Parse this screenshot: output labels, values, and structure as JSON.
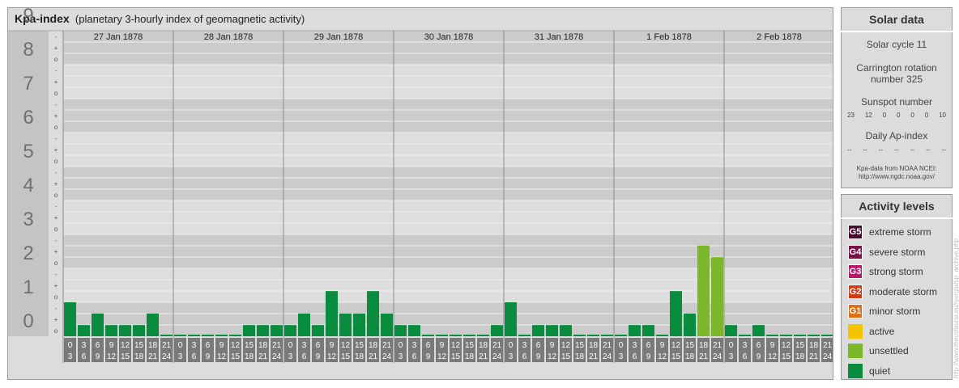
{
  "header": {
    "title": "Kpa-index",
    "subtitle": "(planetary 3-hourly index of geomagnetic activity)"
  },
  "chart_data": {
    "type": "bar",
    "title": "Kpa-index",
    "subtitle": "(planetary 3-hourly index of geomagnetic activity)",
    "ylim": [
      0,
      9
    ],
    "y_ticks": [
      "0",
      "1",
      "2",
      "3",
      "4",
      "5",
      "6",
      "7",
      "8",
      "9"
    ],
    "sub_ticks": [
      "o",
      "+",
      "-"
    ],
    "dates": [
      "27 Jan 1878",
      "28 Jan 1878",
      "29 Jan 1878",
      "30 Jan 1878",
      "31 Jan 1878",
      "1 Feb 1878",
      "2 Feb 1878"
    ],
    "interval_start": [
      "0",
      "3",
      "6",
      "9",
      "12",
      "15",
      "18",
      "21"
    ],
    "interval_end": [
      "3",
      "6",
      "9",
      "12",
      "15",
      "18",
      "21",
      "24"
    ],
    "values": [
      [
        1.0,
        0.33,
        0.67,
        0.33,
        0.33,
        0.33,
        0.67,
        0
      ],
      [
        0,
        0,
        0,
        0,
        0,
        0.33,
        0.33,
        0.33
      ],
      [
        0.33,
        0.67,
        0.33,
        1.33,
        0.67,
        0.67,
        1.33,
        0.67
      ],
      [
        0.33,
        0.33,
        0,
        0,
        0,
        0,
        0,
        0.33
      ],
      [
        1.0,
        0,
        0.33,
        0.33,
        0.33,
        0,
        0,
        0
      ],
      [
        0,
        0.33,
        0.33,
        0,
        1.33,
        0.67,
        2.67,
        2.33
      ],
      [
        0.33,
        0,
        0.33,
        0,
        0,
        0,
        0,
        0
      ]
    ],
    "colors": {
      "quiet": "#0a8c3e",
      "unsettled": "#7ab82a"
    },
    "grid": true
  },
  "solar": {
    "title": "Solar data",
    "cycle": "Solar cycle 11",
    "carrington_1": "Carrington rotation",
    "carrington_2": "number 325",
    "sunspot_title": "Sunspot number",
    "sunspots": [
      "23",
      "12",
      "0",
      "0",
      "0",
      "0",
      "10"
    ],
    "ap_title": "Daily Ap-index",
    "ap": [
      "--",
      "--",
      "--",
      "--",
      "--",
      "--",
      "--"
    ],
    "note_1": "Kpa-data from NOAA NCEI:",
    "note_2": "http://www.ngdc.noaa.gov/"
  },
  "levels": {
    "title": "Activity levels",
    "items": [
      {
        "code": "G5",
        "label": "extreme storm",
        "color": "#4a0a2a"
      },
      {
        "code": "G4",
        "label": "severe storm",
        "color": "#7a1048"
      },
      {
        "code": "G3",
        "label": "strong storm",
        "color": "#b8186a"
      },
      {
        "code": "G2",
        "label": "moderate storm",
        "color": "#d03c14"
      },
      {
        "code": "G1",
        "label": "minor storm",
        "color": "#e07018"
      },
      {
        "code": "",
        "label": "active",
        "color": "#f5c400"
      },
      {
        "code": "",
        "label": "unsettled",
        "color": "#7ab82a"
      },
      {
        "code": "",
        "label": "quiet",
        "color": "#0a8c3e"
      }
    ]
  },
  "watermark": "http://www.theusfauna.eu/tyurgia/up_archive.php"
}
